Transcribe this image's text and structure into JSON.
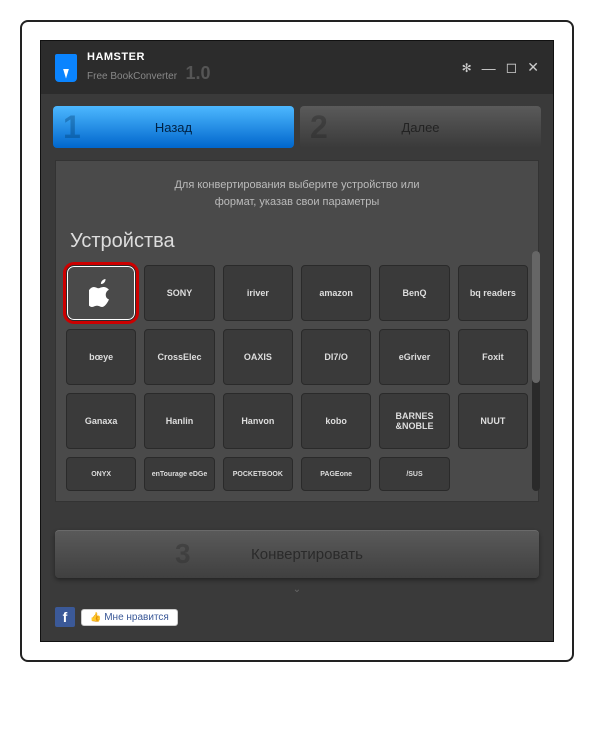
{
  "app": {
    "name": "HAMSTER",
    "subtitle": "Free BookConverter",
    "version": "1.0"
  },
  "steps": {
    "back": {
      "num": "1",
      "label": "Назад"
    },
    "next": {
      "num": "2",
      "label": "Далее"
    },
    "convert": {
      "num": "3",
      "label": "Конвертировать"
    }
  },
  "hint": {
    "line1": "Для конвертирования выберите устройство или",
    "line2": "формат, указав свои параметры"
  },
  "section_title": "Устройства",
  "devices": [
    {
      "id": "apple",
      "label": "",
      "selected": true
    },
    {
      "id": "sony",
      "label": "SONY"
    },
    {
      "id": "iriver",
      "label": "iriver"
    },
    {
      "id": "amazon",
      "label": "amazon"
    },
    {
      "id": "benq",
      "label": "BenQ"
    },
    {
      "id": "bq",
      "label": "bq readers"
    },
    {
      "id": "boeye",
      "label": "bœye"
    },
    {
      "id": "crosselec",
      "label": "CrossElec"
    },
    {
      "id": "oaxis",
      "label": "OAXIS"
    },
    {
      "id": "ditto",
      "label": "DI7/O"
    },
    {
      "id": "egriver",
      "label": "eGriver"
    },
    {
      "id": "foxit",
      "label": "Foxit"
    },
    {
      "id": "ganaxa",
      "label": "Ganaxa"
    },
    {
      "id": "hanlin",
      "label": "Hanlin"
    },
    {
      "id": "hanvon",
      "label": "Hanvon"
    },
    {
      "id": "kobo",
      "label": "kobo"
    },
    {
      "id": "barnes",
      "label": "BARNES &NOBLE"
    },
    {
      "id": "nuut",
      "label": "NUUT"
    },
    {
      "id": "onyx",
      "label": "ONYX"
    },
    {
      "id": "entourage",
      "label": "enTourage eDGe"
    },
    {
      "id": "pocketbook",
      "label": "POCKETBOOK"
    },
    {
      "id": "pageone",
      "label": "PAGEone"
    },
    {
      "id": "asus",
      "label": "/SUS"
    }
  ],
  "footer": {
    "like": "Мне нравится"
  }
}
